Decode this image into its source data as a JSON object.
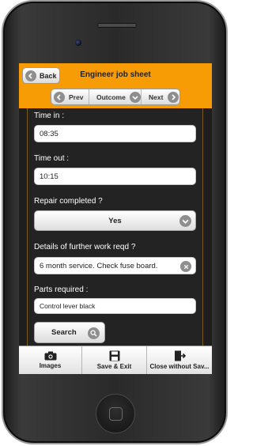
{
  "header": {
    "back_label": "Back",
    "title": "Engineer job sheet",
    "nav": {
      "prev_label": "Prev",
      "outcome_label": "Outcome",
      "next_label": "Next"
    }
  },
  "form": {
    "time_in": {
      "label": "Time in :",
      "value": "08:35"
    },
    "time_out": {
      "label": "Time out :",
      "value": "10:15"
    },
    "repair_completed": {
      "label": "Repair completed ?",
      "value": "Yes"
    },
    "further_work": {
      "label": "Details of further work reqd ?",
      "value": "6 month service. Check fuse board."
    },
    "parts_required": {
      "label": "Parts required :",
      "value": "Control lever black"
    },
    "search_label": "Search"
  },
  "footer": {
    "images_label": "Images",
    "save_exit_label": "Save & Exit",
    "close_label": "Close without Sav..."
  },
  "colors": {
    "header_bg": "#f89c06",
    "content_bg": "#232323",
    "icon_grey": "#8e8e8e"
  },
  "icons": [
    "back-arrow-icon",
    "prev-arrow-icon",
    "dropdown-arrow-icon",
    "next-arrow-icon",
    "clear-icon",
    "search-icon",
    "camera-icon",
    "floppy-disk-icon",
    "exit-door-icon"
  ]
}
